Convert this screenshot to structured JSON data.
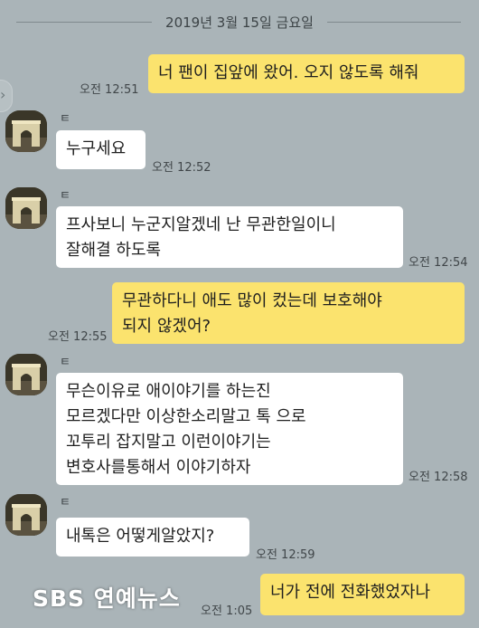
{
  "chat": {
    "date": "2019년 3월 15일 금요일",
    "sender_name": "ㅌ",
    "messages": [
      {
        "from": "me",
        "text": "너 팬이 집앞에 왔어. 오지 않도록 해줘",
        "time": "오전 12:51"
      },
      {
        "from": "other",
        "text": "누구세요",
        "time": "오전 12:52"
      },
      {
        "from": "other",
        "text": "프사보니 누군지알겠네 난 무관한일이니\n잘해결 하도록",
        "time": "오전 12:54"
      },
      {
        "from": "me",
        "text": "무관하다니 애도 많이 컸는데 보호해야\n되지 않겠어?",
        "time": "오전 12:55"
      },
      {
        "from": "other",
        "text": "무슨이유로 애이야기를 하는진\n모르겠다만 이상한소리말고 톡 으로\n꼬투리 잡지말고 이런이야기는\n변호사를통해서 이야기하자",
        "time": "오전 12:58"
      },
      {
        "from": "other",
        "text": "내톡은 어떻게알았지?",
        "time": "오전 12:59"
      },
      {
        "from": "me",
        "text": "너가 전에 전화했었자나",
        "time": "오전 1:05"
      }
    ]
  },
  "watermark": "SBS 연예뉴스",
  "colors": {
    "background": "#aab4b8",
    "my_bubble": "#fbe36e",
    "other_bubble": "#ffffff"
  },
  "icons": {
    "avatar": "arch-photo",
    "side": "chevron-left-icon"
  }
}
